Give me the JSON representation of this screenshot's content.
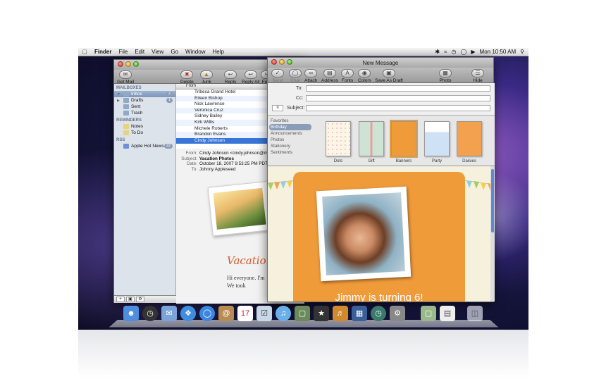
{
  "menubar": {
    "app": "Finder",
    "items": [
      "File",
      "Edit",
      "View",
      "Go",
      "Window",
      "Help"
    ],
    "clock": "Mon 10:50 AM"
  },
  "mail": {
    "toolbar": {
      "get_mail": "Get Mail",
      "delete": "Delete",
      "junk": "Junk",
      "reply": "Reply",
      "reply_all": "Reply All",
      "forward": "Forw"
    },
    "sections": {
      "mailboxes": "MAILBOXES",
      "reminders": "REMINDERS",
      "rss": "RSS"
    },
    "mailboxes": [
      {
        "label": "Inbox",
        "badge": "2"
      },
      {
        "label": "Drafts",
        "badge": "1"
      },
      {
        "label": "Sent",
        "badge": ""
      },
      {
        "label": "Trash",
        "badge": ""
      }
    ],
    "reminders": [
      "Notes",
      "To Do"
    ],
    "rss": [
      {
        "label": "Apple Hot News",
        "badge": "22"
      }
    ],
    "list_header": "From",
    "list": [
      "Tribeca Grand Hotel",
      "Eileen Bishop",
      "Nick Lawrence",
      "Veronica Cruz",
      "Sidney Bailey",
      "Kirk Willis",
      "Michele Roberts",
      "Brandon Evans",
      "Cindy Johnson"
    ],
    "message": {
      "from_label": "From:",
      "from": "Cindy Johnson <cindy.johnson@ma",
      "subject_label": "Subject:",
      "subject": "Vacation Photos",
      "date_label": "Date:",
      "date": "October 18, 2007 9:53:25 PM PDT",
      "to_label": "To:",
      "to": "Johnny Appleseed",
      "body_title": "Vacation",
      "body_line1": "Hi everyone. I'm",
      "body_line2": "We took"
    }
  },
  "newmsg": {
    "title": "New Message",
    "toolbar": {
      "send": "Send",
      "chat": "Chat",
      "attach": "Attach",
      "address": "Address",
      "fonts": "Fonts",
      "colors": "Colors",
      "save_draft": "Save As Draft",
      "photo_browser": "Photo Browser",
      "hide_stationery": "Hide Stationery"
    },
    "fields": {
      "to": "To:",
      "cc": "Cc:",
      "subject": "Subject:"
    },
    "categories": [
      "Favorites",
      "Birthday",
      "Announcements",
      "Photos",
      "Stationery",
      "Sentiments"
    ],
    "templates": [
      "Dots",
      "Gift",
      "Banners",
      "Party",
      "Daisies"
    ],
    "card_title": "Jimmy is turning 6!"
  },
  "dock_icons": [
    "finder-icon",
    "dashboard-icon",
    "mail-icon",
    "safari-icon",
    "ichat-icon",
    "address-book-icon",
    "ical-icon",
    "preview-icon",
    "itunes-icon",
    "iphoto-icon",
    "imovie-icon",
    "garageband-icon",
    "spaces-icon",
    "time-machine-icon",
    "system-preferences-icon",
    "photo-icon",
    "document-icon",
    "trash-icon"
  ]
}
